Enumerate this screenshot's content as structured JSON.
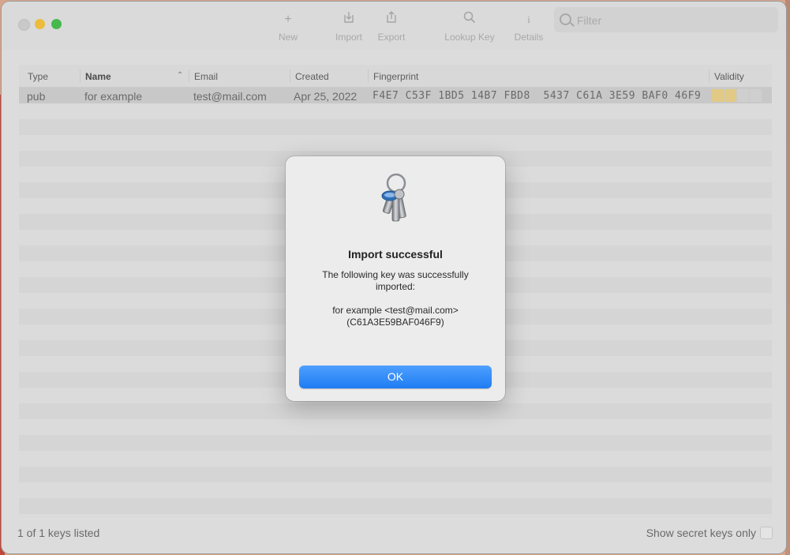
{
  "toolbar": {
    "new_label": "New",
    "import_label": "Import",
    "export_label": "Export",
    "lookup_label": "Lookup Key",
    "details_label": "Details",
    "filter_placeholder": "Filter"
  },
  "table": {
    "columns": [
      "Type",
      "Name",
      "Email",
      "Created",
      "Fingerprint",
      "Validity"
    ],
    "rows": [
      {
        "type": "pub",
        "name": "for example",
        "email": "test@mail.com",
        "created": "Apr 25, 2022",
        "fingerprint": "F4E7 C53F 1BD5 14B7 FBD8  5437 C61A 3E59 BAF0 46F9",
        "validity_colors": [
          "#e1ca86",
          "#e1ca86",
          "#cfcfcf",
          "#cfcfcf"
        ]
      }
    ]
  },
  "footer": {
    "count_text": "1 of 1 keys listed",
    "secret_label": "Show secret keys only"
  },
  "dialog": {
    "title": "Import successful",
    "message": "The following key was successfully imported:",
    "detail_line1": "for example <test@mail.com>",
    "detail_line2": "(C61A3E59BAF046F9)",
    "ok_label": "OK"
  },
  "colors": {
    "accent": "#1f7cf2",
    "validity_full": "#e1ca86"
  }
}
